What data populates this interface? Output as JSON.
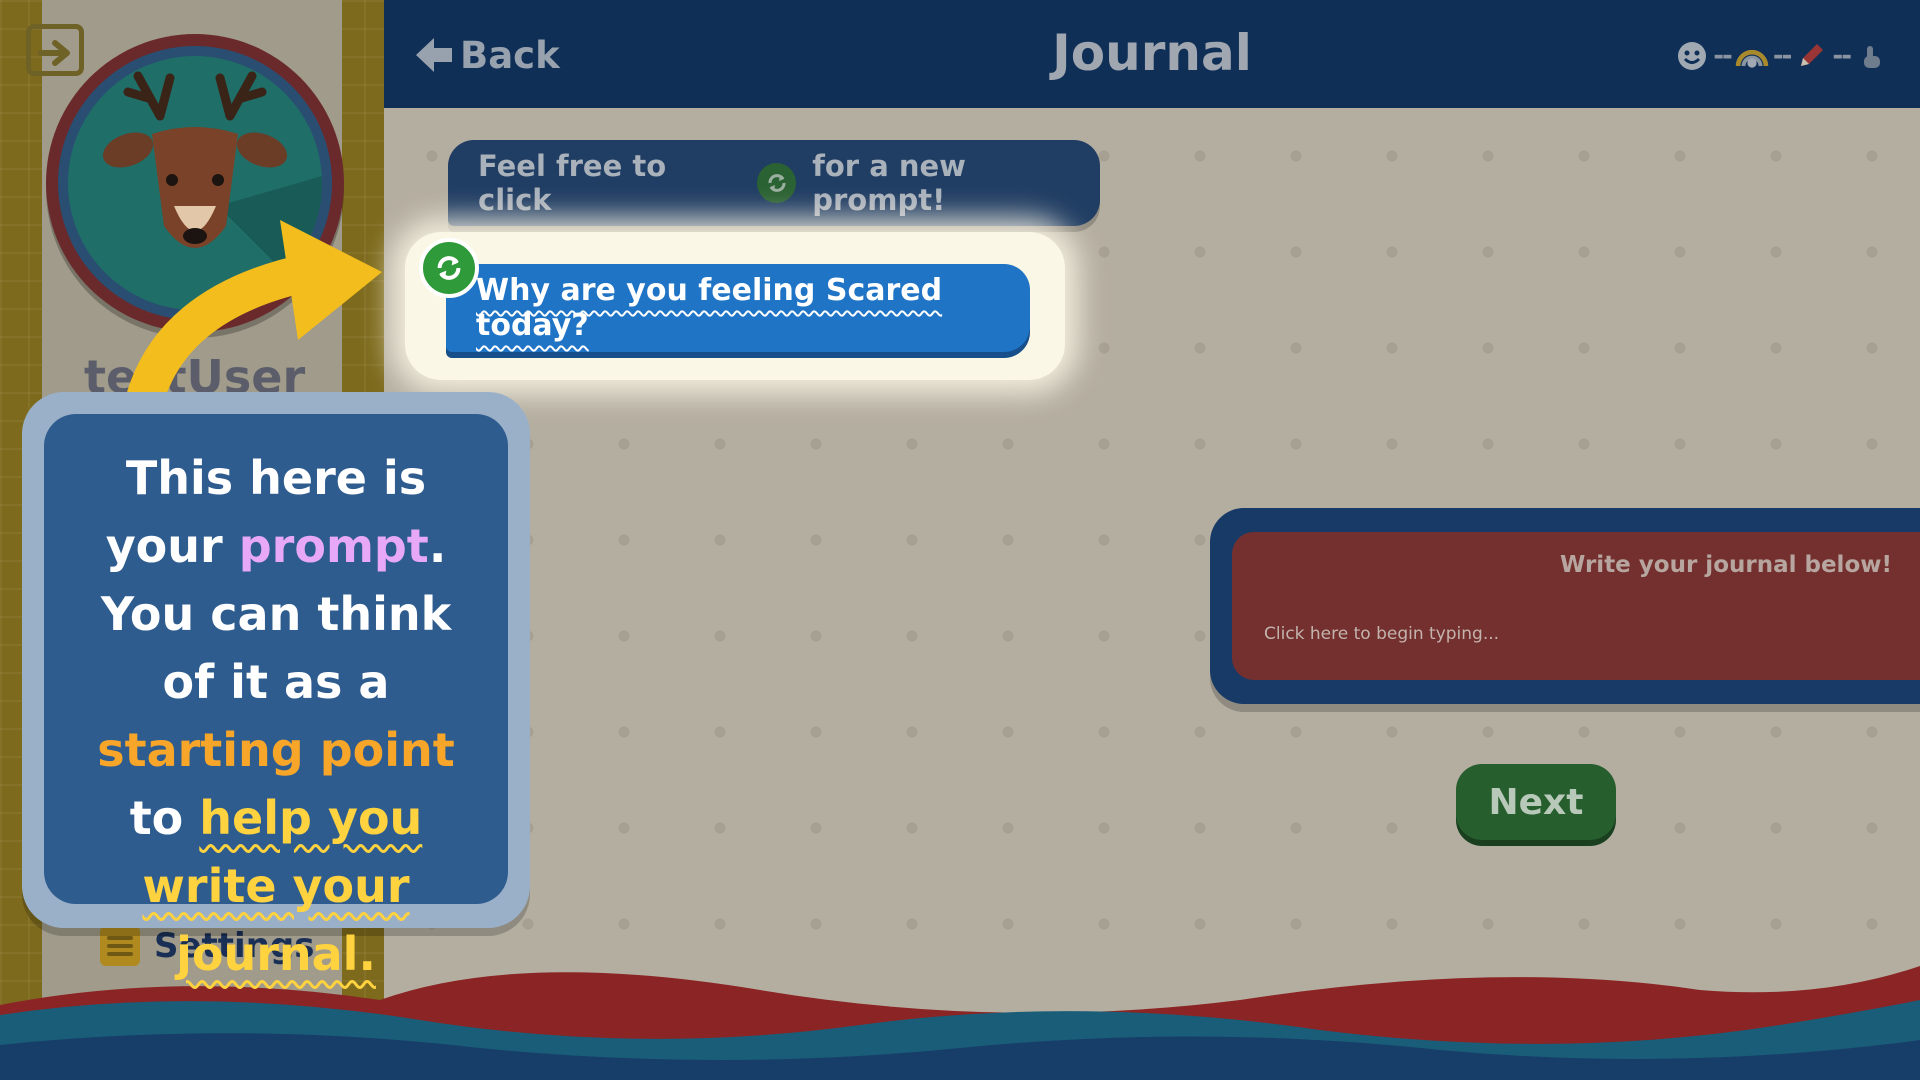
{
  "sidebar": {
    "username": "testUser",
    "settings_label": "Settings",
    "exit_icon": "exit-icon",
    "avatar_icon": "deer-avatar"
  },
  "header": {
    "back_label": "Back",
    "title": "Journal",
    "progress_steps": [
      "emotion-face-icon",
      "rainbow-icon",
      "pencil-icon",
      "finger-tap-icon"
    ]
  },
  "main": {
    "hint_before": "Feel free to click",
    "hint_after": "for a new prompt!",
    "prompt": "Why are you feeling Scared today?",
    "journal_heading": "Write your journal below!",
    "journal_placeholder": "Click here to begin typing...",
    "next_label": "Next"
  },
  "tutorial": {
    "line_a": "This here is your",
    "word_prompt": "prompt",
    "line_b": ". You can think of it as a",
    "word_start": "starting point",
    "line_c": "to",
    "phrase_help": "help you write your journal."
  },
  "colors": {
    "header_bg": "#0f2f57",
    "prompt_blue": "#1f74c6",
    "refresh_green": "#2e9a3a",
    "journal_red": "#74302f",
    "next_green": "#265e2e",
    "tutorial_blue": "#2f5c8f",
    "highlight_purple": "#e6a8f7",
    "highlight_orange": "#f7a629",
    "highlight_yellow": "#ffd23f"
  }
}
